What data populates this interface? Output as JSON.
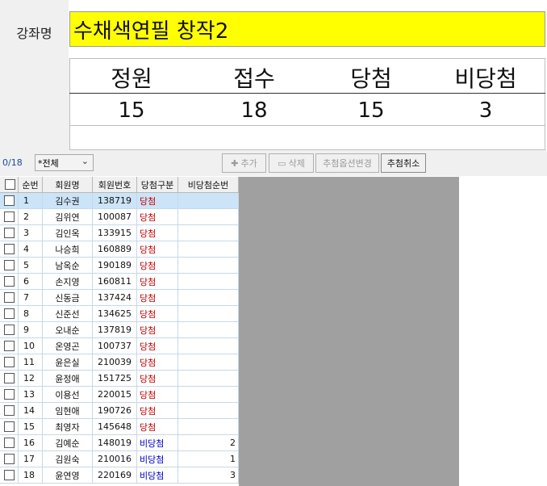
{
  "course": {
    "label": "강좌명",
    "name": "수채색연필 창작2"
  },
  "stats": {
    "headers": [
      "정원",
      "접수",
      "당첨",
      "비당첨"
    ],
    "values": [
      "15",
      "18",
      "15",
      "3"
    ]
  },
  "toolbar": {
    "count": "0/18",
    "filter": "*전체",
    "buttons": [
      "추가",
      "삭제",
      "추첨옵션변경",
      "추첨취소"
    ]
  },
  "table": {
    "columns": [
      "순번",
      "회원명",
      "회원번호",
      "당첨구분",
      "비당첨순번"
    ],
    "rows": [
      [
        "1",
        "김수권",
        "138719",
        "당첨",
        ""
      ],
      [
        "2",
        "김위연",
        "100087",
        "당첨",
        ""
      ],
      [
        "3",
        "김인옥",
        "133915",
        "당첨",
        ""
      ],
      [
        "4",
        "나승희",
        "160889",
        "당첨",
        ""
      ],
      [
        "5",
        "남옥순",
        "190189",
        "당첨",
        ""
      ],
      [
        "6",
        "손지영",
        "160811",
        "당첨",
        ""
      ],
      [
        "7",
        "신동금",
        "137424",
        "당첨",
        ""
      ],
      [
        "8",
        "신준선",
        "134625",
        "당첨",
        ""
      ],
      [
        "9",
        "오내순",
        "137819",
        "당첨",
        ""
      ],
      [
        "10",
        "온영곤",
        "100737",
        "당첨",
        ""
      ],
      [
        "11",
        "윤은실",
        "210039",
        "당첨",
        ""
      ],
      [
        "12",
        "윤정애",
        "151725",
        "당첨",
        ""
      ],
      [
        "13",
        "이용선",
        "220015",
        "당첨",
        ""
      ],
      [
        "14",
        "임현애",
        "190726",
        "당첨",
        ""
      ],
      [
        "15",
        "최영자",
        "145648",
        "당첨",
        ""
      ],
      [
        "16",
        "김예순",
        "148019",
        "비당첨",
        "2"
      ],
      [
        "17",
        "김원숙",
        "210016",
        "비당첨",
        "1"
      ],
      [
        "18",
        "윤연영",
        "220169",
        "비당첨",
        "3"
      ]
    ]
  },
  "colors": {
    "course_bg": "#ffff00",
    "won": "#c00000",
    "lost": "#0000c0",
    "selected_row": "#cce4f7",
    "empty_area": "#a0a0a0"
  }
}
